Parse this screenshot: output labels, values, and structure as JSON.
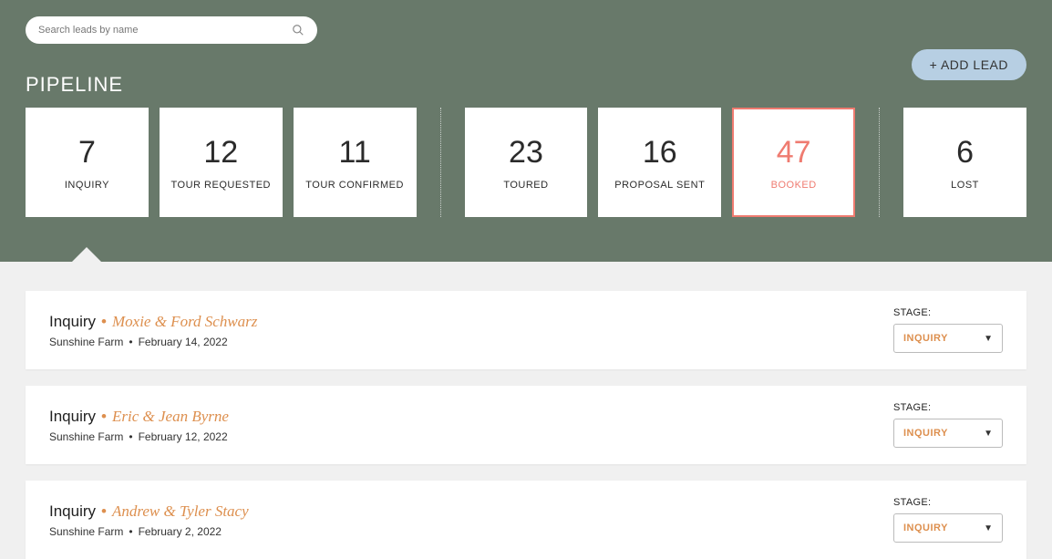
{
  "search": {
    "placeholder": "Search leads by name"
  },
  "title": "PIPELINE",
  "add_lead_label": "+ ADD LEAD",
  "stages": [
    {
      "count": "7",
      "label": "INQUIRY",
      "selected": true,
      "highlight": false
    },
    {
      "count": "12",
      "label": "TOUR REQUESTED",
      "selected": false,
      "highlight": false
    },
    {
      "count": "11",
      "label": "TOUR CONFIRMED",
      "selected": false,
      "highlight": false
    },
    {
      "count": "23",
      "label": "TOURED",
      "selected": false,
      "highlight": false
    },
    {
      "count": "16",
      "label": "PROPOSAL SENT",
      "selected": false,
      "highlight": false
    },
    {
      "count": "47",
      "label": "BOOKED",
      "selected": false,
      "highlight": true
    },
    {
      "count": "6",
      "label": "LOST",
      "selected": false,
      "highlight": false
    }
  ],
  "stage_select_label": "STAGE:",
  "leads": [
    {
      "stage": "Inquiry",
      "names": "Moxie & Ford Schwarz",
      "venue": "Sunshine Farm",
      "date": "February 14, 2022",
      "selected_stage": "INQUIRY"
    },
    {
      "stage": "Inquiry",
      "names": "Eric & Jean Byrne",
      "venue": "Sunshine Farm",
      "date": "February 12, 2022",
      "selected_stage": "INQUIRY"
    },
    {
      "stage": "Inquiry",
      "names": "Andrew & Tyler Stacy",
      "venue": "Sunshine Farm",
      "date": "February 2, 2022",
      "selected_stage": "INQUIRY"
    }
  ]
}
